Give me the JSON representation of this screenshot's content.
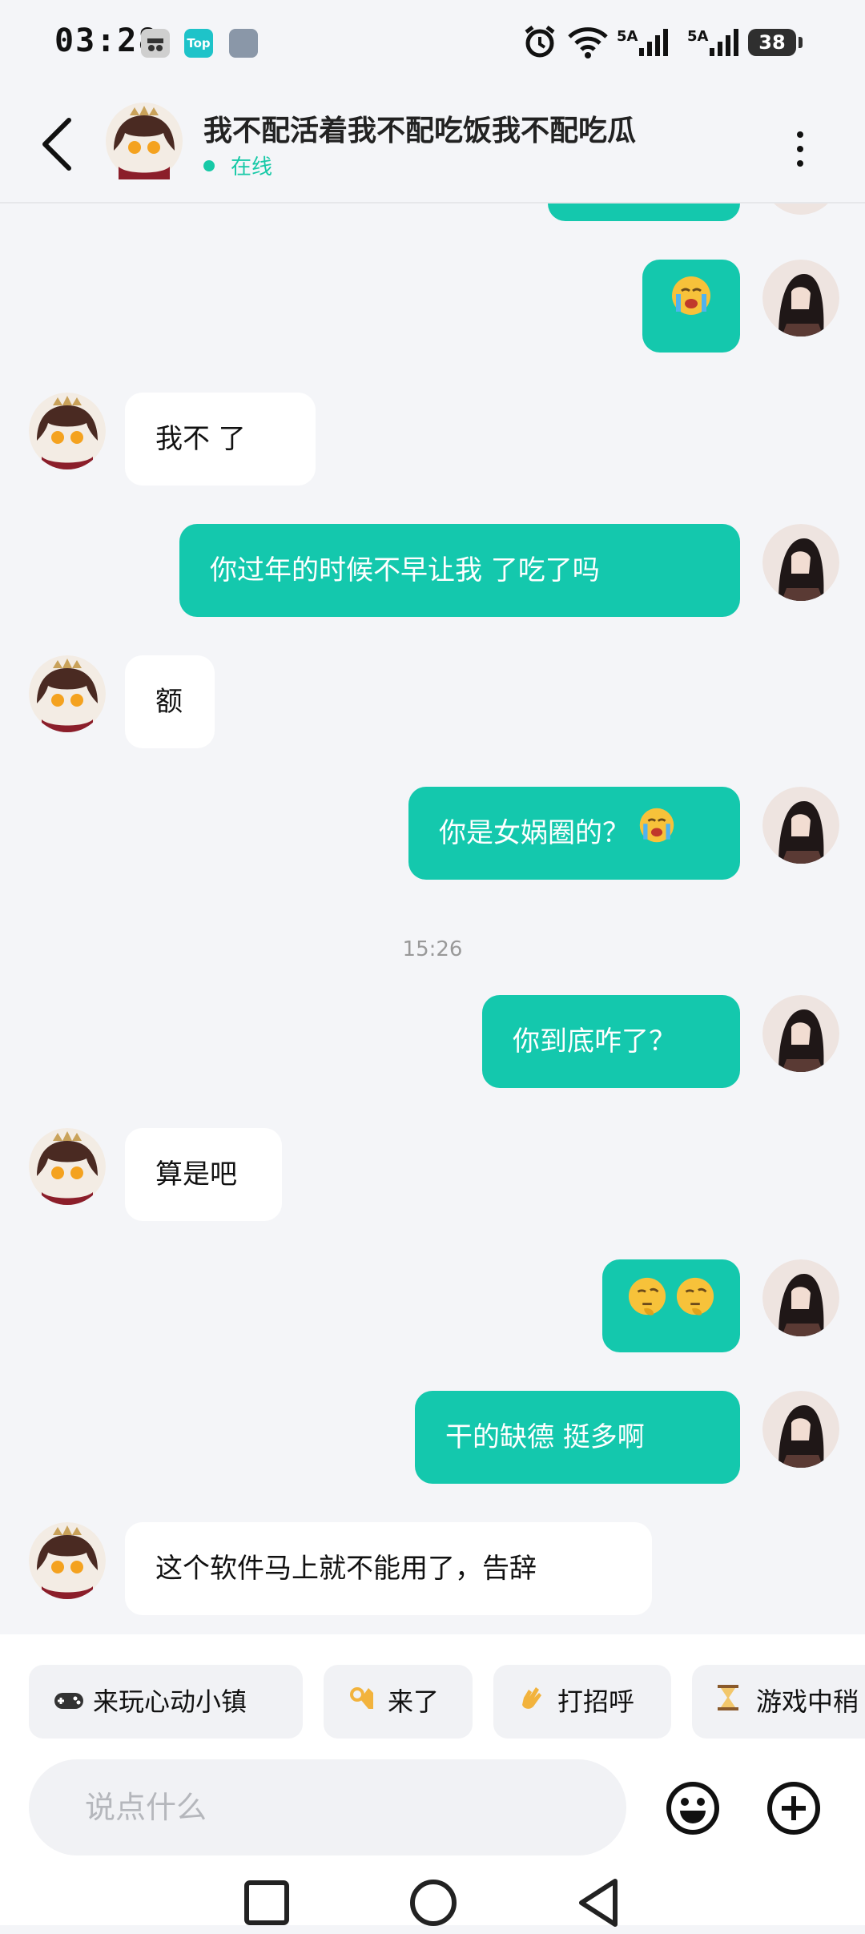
{
  "status_bar": {
    "time": "03:28",
    "app_icon_top_label": "Top",
    "signal1": "5A",
    "signal2": "5A",
    "battery": "38"
  },
  "header": {
    "contact_name": "我不配活着我不配吃饭我不配吃瓜",
    "status": "在线"
  },
  "messages": [
    {
      "side": "out",
      "text": "",
      "emoji": [
        "crying-face"
      ]
    },
    {
      "side": "in",
      "text": "我不 了"
    },
    {
      "side": "out",
      "text": "你过年的时候不早让我 了吃了吗"
    },
    {
      "side": "in",
      "text": "额"
    },
    {
      "side": "out",
      "text": "你是女娲圈的？",
      "emoji": [
        "crying-face"
      ]
    },
    {
      "time": "15:26"
    },
    {
      "side": "out",
      "text": "你到底咋了？"
    },
    {
      "side": "in",
      "text": "算是吧"
    },
    {
      "side": "out",
      "text": "",
      "emoji": [
        "thinking-face",
        "thinking-face"
      ]
    },
    {
      "side": "out",
      "text": "干的缺德 挺多啊"
    },
    {
      "side": "in",
      "text": "这个软件马上就不能用了，告辞"
    }
  ],
  "quick_replies": [
    {
      "icon": "gamepad",
      "label": "来玩心动小镇"
    },
    {
      "icon": "ok-hand",
      "label": "来了"
    },
    {
      "icon": "waving-hand",
      "label": "打招呼"
    },
    {
      "icon": "hourglass",
      "label": "游戏中稍"
    }
  ],
  "input": {
    "placeholder": "说点什么",
    "value": ""
  },
  "colors": {
    "accent": "#14c8ad",
    "online": "#17c9a7",
    "background": "#f4f5f8"
  },
  "icons": [
    "back-arrow-icon",
    "more-vertical-icon",
    "emoji-icon",
    "add-circle-icon",
    "nav-recents-icon",
    "nav-home-icon",
    "nav-back-icon"
  ]
}
